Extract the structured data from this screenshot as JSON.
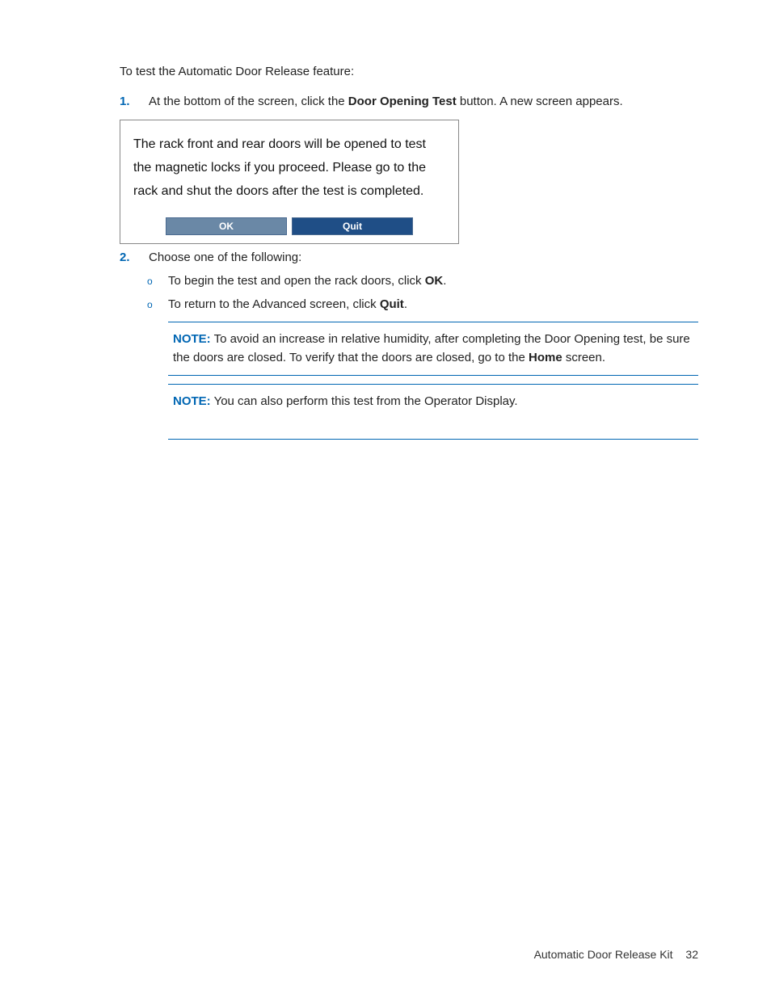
{
  "intro": "To test the Automatic Door Release feature:",
  "step1": {
    "num": "1.",
    "pre": "At the bottom of the screen, click the ",
    "bold": "Door Opening Test",
    "post": " button. A new screen appears."
  },
  "dialog": {
    "text": "The rack front and rear doors will be opened to test the magnetic locks if you proceed. Please go to the rack and shut the doors after the test is completed.",
    "ok": "OK",
    "quit": "Quit"
  },
  "step2": {
    "num": "2.",
    "text": "Choose one of the following:"
  },
  "sub1": {
    "bullet": "o",
    "pre": "To begin the test and open the rack doors, click ",
    "bold": "OK",
    "post": "."
  },
  "sub2": {
    "bullet": "o",
    "pre": "To return to the Advanced screen, click ",
    "bold": "Quit",
    "post": "."
  },
  "note1": {
    "label": "NOTE:",
    "pre": "  To avoid an increase in relative humidity, after completing the Door Opening test, be sure the doors are closed. To verify that the doors are closed, go to the ",
    "bold": "Home",
    "post": " screen."
  },
  "note2": {
    "label": "NOTE:",
    "text": "  You can also perform this test from the Operator Display."
  },
  "footer": {
    "title": "Automatic Door Release Kit",
    "page": "32"
  }
}
